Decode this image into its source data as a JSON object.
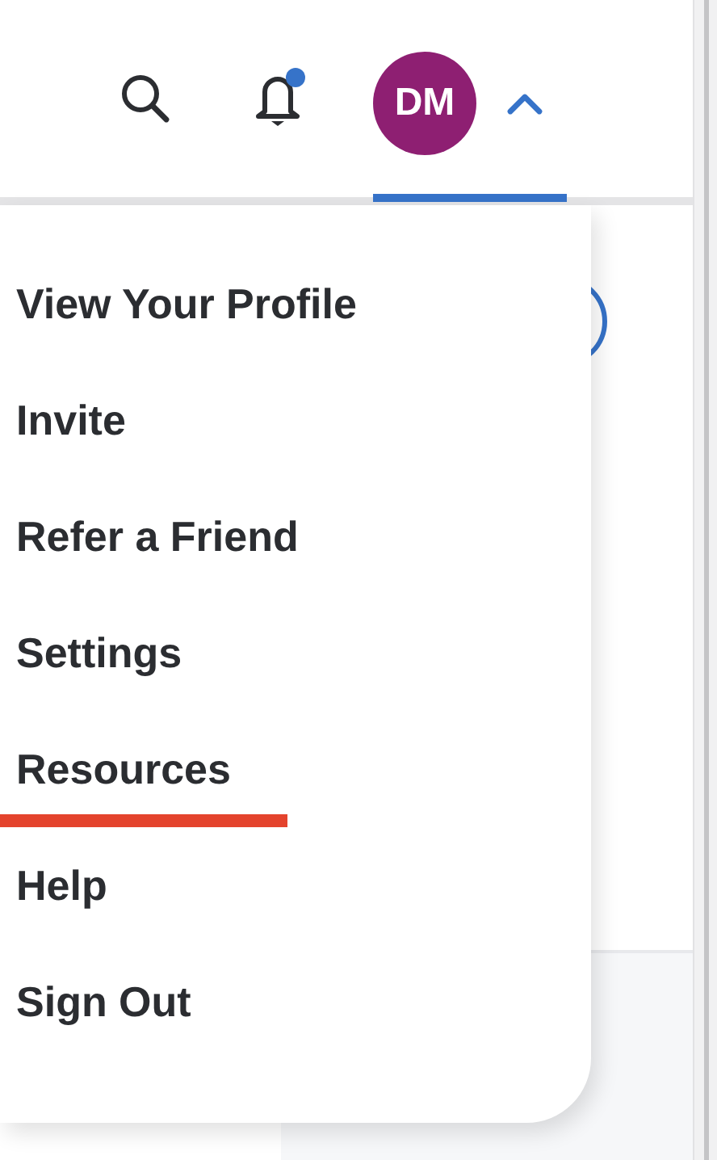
{
  "header": {
    "notifications_unread": true,
    "avatar": {
      "initials": "DM"
    },
    "menu_expanded": true
  },
  "menu": {
    "items": [
      {
        "label": "View Your Profile",
        "highlighted": false
      },
      {
        "label": "Invite",
        "highlighted": false
      },
      {
        "label": "Refer a Friend",
        "highlighted": false
      },
      {
        "label": "Settings",
        "highlighted": false
      },
      {
        "label": "Resources",
        "highlighted": true
      },
      {
        "label": "Help",
        "highlighted": false
      },
      {
        "label": "Sign Out",
        "highlighted": false
      }
    ]
  }
}
